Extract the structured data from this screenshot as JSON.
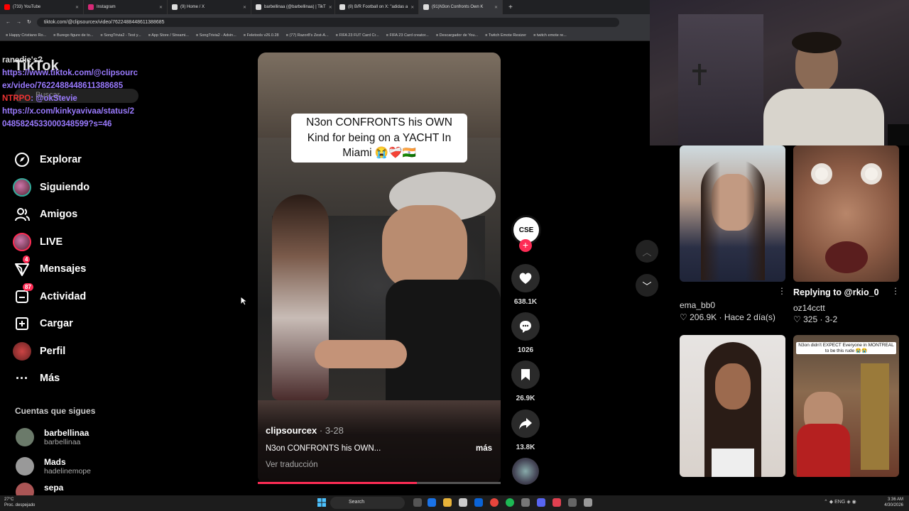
{
  "browser": {
    "tabs": [
      {
        "label": "(733) YouTube",
        "color": "#ff0000"
      },
      {
        "label": "Instagram",
        "color": "#d62976"
      },
      {
        "label": "(9) Home / X",
        "color": "#ffffff"
      },
      {
        "label": "barbellinaa (@barbellinaa) | TikT",
        "color": "#ffffff"
      },
      {
        "label": "(8) B/R Football on X: \"adidas a",
        "color": "#ffffff"
      },
      {
        "label": "(91)N3on Confronts Own K",
        "color": "#ffffff"
      }
    ],
    "active_tab": 5,
    "url": "tiktok.com/@clipsourcex/video/7622488448611388685",
    "bookmarks": [
      "Happy Cristiano Ro...",
      "Burego figure de to...",
      "SongTrivia2 - Test y...",
      "App Store / Streami...",
      "SongTrivia2 - Advin...",
      "Feletools v26.0.28",
      "(77) Razor8's Zest-A...",
      "FIFA 23 FUT Card Cr...",
      "FIFA 23 Card creator...",
      "Descargador de You...",
      "Twitch Emote Resizer",
      "twitch emote re..."
    ]
  },
  "chat": {
    "user": "ranedie's?",
    "link1": "https://www.tiktok.com/@clipsourc",
    "link1b": "ex/video/7622488448611388685",
    "badge": "NTRPO",
    "mention": ": @okStevie",
    "link2": "https://x.com/kinkyavivaa/status/2",
    "link2b": "0485824533000348599?s=46"
  },
  "sidebar": {
    "logo": "TikTok",
    "search_placeholder": "Buscar",
    "items": [
      {
        "label": "Explorar",
        "icon": "compass-icon",
        "badge": ""
      },
      {
        "label": "Siguiendo",
        "icon": "avatar-ring-icon",
        "badge": ""
      },
      {
        "label": "Amigos",
        "icon": "friends-icon",
        "badge": ""
      },
      {
        "label": "LIVE",
        "icon": "live-icon",
        "badge": ""
      },
      {
        "label": "Mensajes",
        "icon": "message-icon",
        "badge": "4"
      },
      {
        "label": "Actividad",
        "icon": "activity-icon",
        "badge": "87"
      },
      {
        "label": "Cargar",
        "icon": "upload-icon",
        "badge": ""
      },
      {
        "label": "Perfil",
        "icon": "profile-icon",
        "badge": ""
      },
      {
        "label": "Más",
        "icon": "more-icon",
        "badge": ""
      }
    ],
    "following_title": "Cuentas que sigues",
    "following": [
      {
        "name": "barbellinaa",
        "handle": "barbellinaa"
      },
      {
        "name": "Mads",
        "handle": "hadelinemope"
      },
      {
        "name": "sepa",
        "handle": ""
      }
    ]
  },
  "video": {
    "caption": "N3on CONFRONTS his OWN Kind for being on a YACHT In Miami 😭❤️‍🩹🇮🇳",
    "author": "clipsourcex",
    "date": " · 3-28",
    "description": "N3on CONFRONTS his OWN...",
    "more": "más",
    "translate": "Ver traducción",
    "progress": 0.655
  },
  "actions": {
    "creator_label": "CSE",
    "likes": "638.1K",
    "comments": "1026",
    "saves": "26.9K",
    "shares": "13.8K"
  },
  "related": [
    {
      "author": "ema_bb0",
      "likes": "206.9K",
      "date": "Hace 2 día(s)",
      "title": ""
    },
    {
      "author": "oz14cctt",
      "likes": "325",
      "date": "3-2",
      "title": "Replying to @rkio_0"
    },
    {
      "author": "",
      "likes": "",
      "date": "",
      "title": ""
    },
    {
      "author": "",
      "likes": "",
      "date": "",
      "title": "N3on didn't EXPECT Everyone in MONTREAL to be this rude 😭😭"
    }
  ],
  "taskbar": {
    "temp": "27°C",
    "weather": "Proc. despejado",
    "search": "Search",
    "lang": "ENG",
    "time": "3:36 AM",
    "date": "4/30/2026"
  }
}
